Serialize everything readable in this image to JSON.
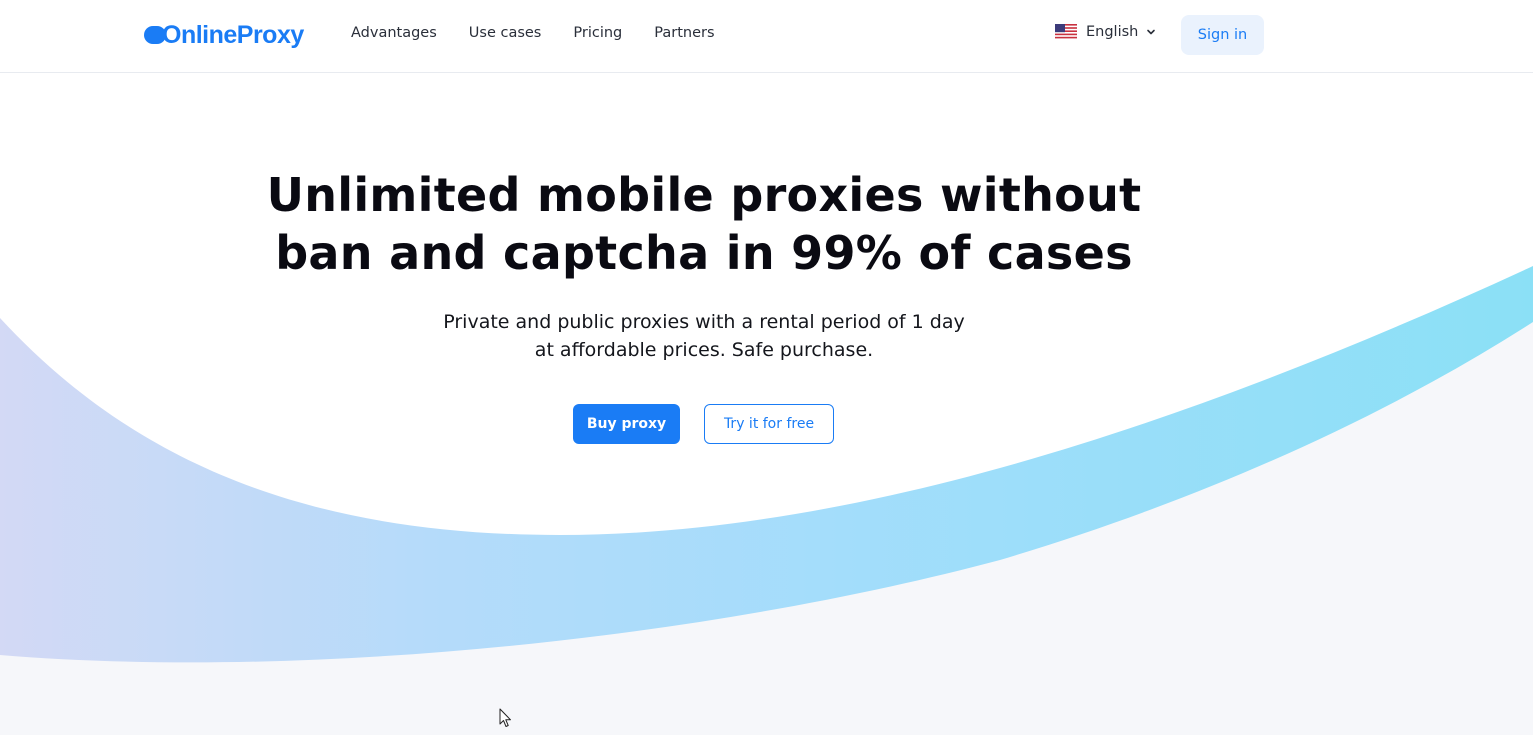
{
  "header": {
    "logo_text": "OnlineProxy",
    "nav": [
      {
        "label": "Advantages"
      },
      {
        "label": "Use cases"
      },
      {
        "label": "Pricing"
      },
      {
        "label": "Partners"
      }
    ],
    "language": {
      "label": "English",
      "flag_icon": "us-flag-icon",
      "chevron_icon": "chevron-down-icon"
    },
    "signin_label": "Sign in"
  },
  "hero": {
    "title_line1": "Unlimited mobile proxies without",
    "title_line2": "ban and captcha in 99% of cases",
    "subtitle_line1": "Private and public proxies with a rental period of 1 day",
    "subtitle_line2": "at affordable prices. Safe purchase.",
    "primary_button": "Buy proxy",
    "secondary_button": "Try it for free"
  },
  "colors": {
    "brand": "#1a7cf5",
    "signin_bg": "#eaf2fd",
    "text": "#0a0a12",
    "wave_light_blue": "#8fdcf5",
    "wave_lavender": "#d6dcf6",
    "section_bg": "#f6f7fa"
  }
}
